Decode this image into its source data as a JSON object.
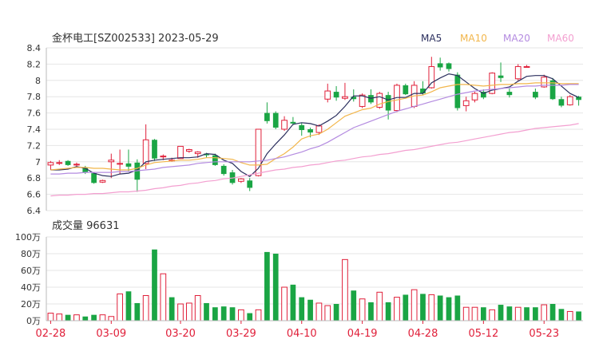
{
  "header": {
    "title": "金杯电工[SZ002533] 2023-05-29",
    "legend": [
      {
        "label": "MA5",
        "color": "#2b2f5e"
      },
      {
        "label": "MA10",
        "color": "#f2b64b"
      },
      {
        "label": "MA20",
        "color": "#b48be0"
      },
      {
        "label": "MA60",
        "color": "#f39fd0"
      }
    ]
  },
  "colors": {
    "up": "#e0203a",
    "down": "#1aa544",
    "grid": "#e6e6e6",
    "axis_text": "#333333"
  },
  "chart_data": [
    {
      "type": "candlestick",
      "ylim": [
        6.4,
        8.4
      ],
      "y_ticks": [
        "8.4",
        "8.2",
        "8",
        "7.8",
        "7.6",
        "7.4",
        "7.2",
        "7",
        "6.8",
        "6.6",
        "6.4"
      ],
      "y_tick_values": [
        8.4,
        8.2,
        8.0,
        7.8,
        7.6,
        7.4,
        7.2,
        7.0,
        6.8,
        6.6,
        6.4
      ],
      "candles": [
        [
          6.96,
          6.99,
          7.01,
          6.9
        ],
        [
          6.98,
          6.99,
          7.02,
          6.96
        ],
        [
          7.01,
          6.96,
          7.02,
          6.95
        ],
        [
          6.96,
          6.97,
          6.99,
          6.94
        ],
        [
          6.93,
          6.87,
          6.95,
          6.85
        ],
        [
          6.86,
          6.74,
          6.87,
          6.73
        ],
        [
          6.75,
          6.77,
          6.78,
          6.74
        ],
        [
          7.0,
          7.02,
          7.1,
          6.8
        ],
        [
          6.97,
          6.98,
          7.15,
          6.85
        ],
        [
          6.98,
          6.94,
          7.15,
          6.88
        ],
        [
          6.99,
          6.78,
          7.03,
          6.63
        ],
        [
          6.98,
          7.27,
          7.46,
          6.91
        ],
        [
          7.27,
          7.04,
          7.28,
          7.01
        ],
        [
          7.06,
          7.07,
          7.09,
          7.02
        ],
        [
          7.02,
          7.02,
          7.05,
          7.0
        ],
        [
          7.04,
          7.19,
          7.19,
          7.04
        ],
        [
          7.13,
          7.15,
          7.16,
          7.11
        ],
        [
          7.1,
          7.12,
          7.13,
          7.05
        ],
        [
          7.1,
          7.08,
          7.11,
          7.05
        ],
        [
          7.08,
          6.96,
          7.1,
          6.95
        ],
        [
          6.95,
          6.85,
          6.97,
          6.83
        ],
        [
          6.87,
          6.74,
          6.9,
          6.72
        ],
        [
          6.76,
          6.79,
          6.8,
          6.74
        ],
        [
          6.77,
          6.68,
          6.8,
          6.64
        ],
        [
          6.83,
          7.4,
          7.4,
          6.82
        ],
        [
          7.6,
          7.5,
          7.73,
          7.47
        ],
        [
          7.6,
          7.42,
          7.62,
          7.4
        ],
        [
          7.4,
          7.51,
          7.56,
          7.38
        ],
        [
          7.49,
          7.47,
          7.55,
          7.45
        ],
        [
          7.45,
          7.39,
          7.48,
          7.32
        ],
        [
          7.4,
          7.36,
          7.42,
          7.3
        ],
        [
          7.36,
          7.44,
          7.46,
          7.33
        ],
        [
          7.77,
          7.87,
          7.96,
          7.73
        ],
        [
          7.86,
          7.79,
          7.93,
          7.75
        ],
        [
          7.78,
          7.8,
          7.97,
          7.76
        ],
        [
          7.8,
          7.77,
          7.89,
          7.74
        ],
        [
          7.68,
          7.82,
          7.84,
          7.66
        ],
        [
          7.82,
          7.73,
          7.89,
          7.71
        ],
        [
          7.67,
          7.84,
          7.86,
          7.65
        ],
        [
          7.82,
          7.63,
          7.86,
          7.52
        ],
        [
          7.63,
          7.94,
          7.96,
          7.61
        ],
        [
          7.94,
          7.83,
          7.96,
          7.82
        ],
        [
          7.68,
          7.94,
          7.99,
          7.66
        ],
        [
          7.9,
          7.84,
          7.99,
          7.82
        ],
        [
          7.91,
          8.17,
          8.29,
          7.9
        ],
        [
          8.21,
          8.16,
          8.28,
          8.12
        ],
        [
          8.21,
          8.14,
          8.22,
          8.11
        ],
        [
          8.07,
          7.66,
          8.1,
          7.63
        ],
        [
          7.69,
          7.75,
          7.8,
          7.62
        ],
        [
          7.76,
          7.84,
          7.86,
          7.73
        ],
        [
          7.86,
          7.79,
          7.89,
          7.77
        ],
        [
          7.84,
          8.09,
          8.1,
          7.83
        ],
        [
          8.06,
          8.03,
          8.22,
          7.98
        ],
        [
          7.86,
          7.82,
          7.9,
          7.79
        ],
        [
          8.02,
          8.17,
          8.2,
          8.0
        ],
        [
          8.17,
          8.17,
          8.19,
          8.16
        ],
        [
          7.86,
          7.79,
          7.9,
          7.77
        ],
        [
          7.92,
          8.04,
          8.07,
          7.91
        ],
        [
          8.0,
          7.77,
          8.03,
          7.76
        ],
        [
          7.77,
          7.69,
          7.8,
          7.67
        ],
        [
          7.7,
          7.8,
          7.82,
          7.69
        ],
        [
          7.8,
          7.76,
          7.81,
          7.69
        ]
      ],
      "ma": {
        "MA5": [
          6.9,
          6.9,
          6.91,
          6.94,
          6.92,
          6.86,
          6.83,
          6.82,
          6.85,
          6.86,
          6.9,
          7.0,
          7.02,
          7.03,
          7.04,
          7.05,
          7.05,
          7.06,
          7.1,
          7.09,
          7.02,
          6.98,
          6.88,
          6.82,
          6.92,
          7.1,
          7.22,
          7.33,
          7.46,
          7.48,
          7.47,
          7.44,
          7.5,
          7.57,
          7.68,
          7.81,
          7.81,
          7.78,
          7.8,
          7.76,
          7.79,
          7.79,
          7.84,
          7.84,
          7.97,
          8.03,
          8.08,
          8.06,
          7.98,
          7.9,
          7.84,
          7.88,
          7.9,
          7.92,
          7.99,
          8.05,
          8.06,
          8.06,
          8.02,
          7.93,
          7.84,
          7.79
        ],
        "MA10": [
          6.9,
          6.91,
          6.92,
          6.93,
          6.93,
          6.92,
          6.92,
          6.91,
          6.9,
          6.9,
          6.92,
          6.96,
          6.99,
          7.0,
          7.01,
          7.02,
          7.02,
          7.03,
          7.05,
          7.05,
          7.04,
          7.03,
          6.99,
          6.96,
          6.96,
          6.97,
          7.04,
          7.1,
          7.18,
          7.28,
          7.32,
          7.34,
          7.4,
          7.48,
          7.56,
          7.6,
          7.64,
          7.66,
          7.71,
          7.74,
          7.76,
          7.78,
          7.81,
          7.82,
          7.86,
          7.91,
          7.93,
          7.95,
          7.95,
          7.94,
          7.93,
          7.94,
          7.95,
          7.95,
          7.96,
          7.96,
          7.97,
          7.97,
          7.97,
          7.96,
          7.96,
          7.96
        ],
        "MA20": [
          6.85,
          6.85,
          6.86,
          6.86,
          6.87,
          6.87,
          6.87,
          6.87,
          6.88,
          6.88,
          6.89,
          6.9,
          6.91,
          6.93,
          6.94,
          6.95,
          6.96,
          6.98,
          6.99,
          7.0,
          7.0,
          7.0,
          7.0,
          7.0,
          7.01,
          7.02,
          7.04,
          7.06,
          7.09,
          7.12,
          7.16,
          7.19,
          7.24,
          7.3,
          7.36,
          7.42,
          7.46,
          7.5,
          7.54,
          7.58,
          7.62,
          7.65,
          7.68,
          7.71,
          7.74,
          7.77,
          7.8,
          7.83,
          7.85,
          7.87,
          7.88,
          7.89,
          7.9,
          7.91,
          7.92,
          7.93,
          7.93,
          7.94,
          7.94,
          7.94,
          7.95,
          7.95
        ],
        "MA60": [
          6.58,
          6.59,
          6.59,
          6.6,
          6.6,
          6.61,
          6.61,
          6.62,
          6.63,
          6.63,
          6.64,
          6.65,
          6.67,
          6.68,
          6.7,
          6.71,
          6.73,
          6.74,
          6.76,
          6.77,
          6.79,
          6.8,
          6.82,
          6.84,
          6.86,
          6.88,
          6.9,
          6.91,
          6.93,
          6.94,
          6.96,
          6.97,
          6.99,
          7.01,
          7.02,
          7.04,
          7.06,
          7.07,
          7.09,
          7.1,
          7.12,
          7.14,
          7.15,
          7.17,
          7.19,
          7.21,
          7.23,
          7.24,
          7.26,
          7.28,
          7.3,
          7.32,
          7.34,
          7.36,
          7.37,
          7.39,
          7.41,
          7.42,
          7.43,
          7.44,
          7.45,
          7.47
        ]
      }
    },
    {
      "type": "bar",
      "title": "成交量 96631",
      "ylim": [
        0,
        100
      ],
      "y_ticks": [
        "100万",
        "80万",
        "60万",
        "40万",
        "20万",
        "0万"
      ],
      "y_tick_values": [
        100,
        80,
        60,
        40,
        20,
        0
      ],
      "values": [
        9,
        8,
        7,
        7,
        5,
        7,
        7,
        5,
        32,
        35,
        21,
        30,
        85,
        56,
        28,
        20,
        21,
        30,
        21,
        16,
        17,
        16,
        13,
        9,
        13,
        82,
        80,
        40,
        43,
        28,
        25,
        21,
        18,
        20,
        73,
        36,
        26,
        22,
        34,
        22,
        28,
        31,
        37,
        32,
        31,
        30,
        28,
        30,
        16,
        16,
        16,
        13,
        19,
        17,
        16,
        16,
        16,
        19,
        20,
        14,
        11,
        11
      ],
      "up_flags": [
        1,
        1,
        0,
        1,
        0,
        0,
        1,
        1,
        1,
        0,
        0,
        1,
        0,
        1,
        0,
        1,
        1,
        1,
        0,
        0,
        0,
        0,
        1,
        0,
        1,
        0,
        0,
        1,
        0,
        0,
        0,
        1,
        1,
        0,
        1,
        0,
        1,
        0,
        1,
        0,
        1,
        0,
        1,
        0,
        1,
        0,
        0,
        0,
        1,
        1,
        0,
        1,
        0,
        0,
        1,
        0,
        0,
        1,
        0,
        0,
        1,
        0
      ],
      "x_ticks": [
        {
          "label": "02-28",
          "index": 0
        },
        {
          "label": "03-09",
          "index": 7
        },
        {
          "label": "03-20",
          "index": 15
        },
        {
          "label": "03-29",
          "index": 22
        },
        {
          "label": "04-10",
          "index": 29
        },
        {
          "label": "04-19",
          "index": 36
        },
        {
          "label": "04-28",
          "index": 43
        },
        {
          "label": "05-12",
          "index": 50
        },
        {
          "label": "05-23",
          "index": 57
        }
      ]
    }
  ]
}
